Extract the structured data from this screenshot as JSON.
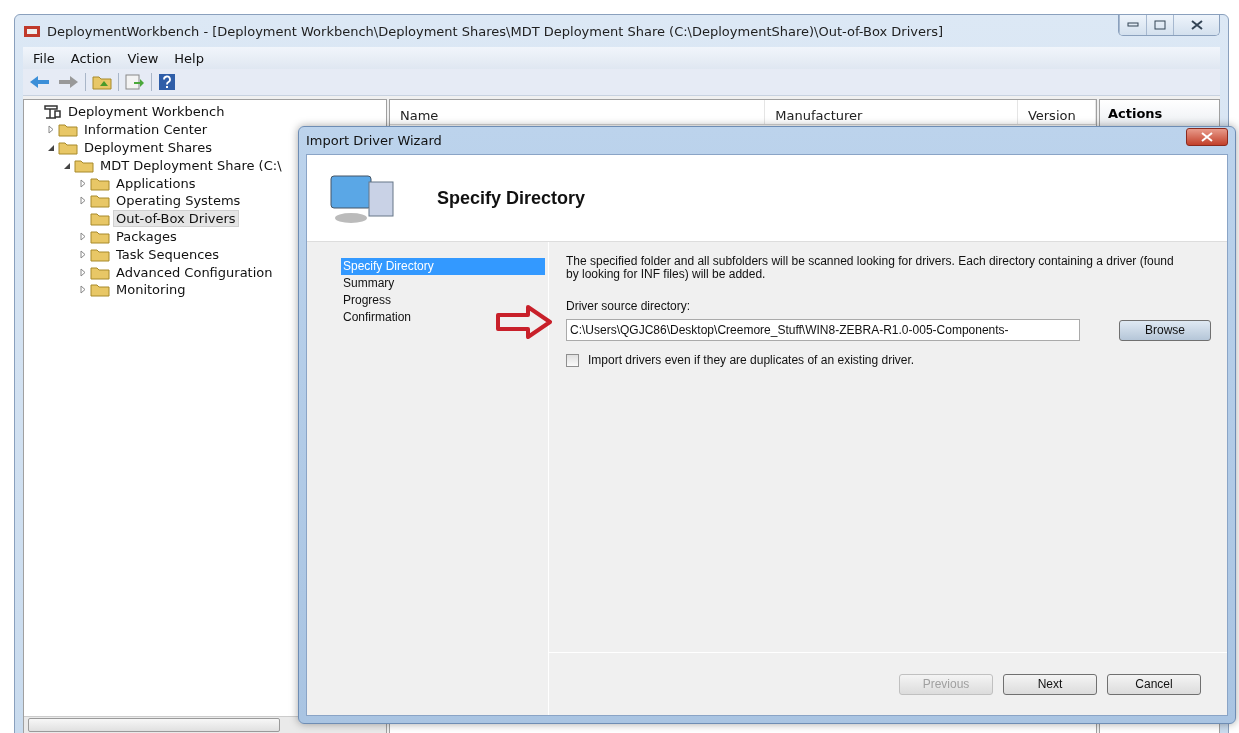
{
  "window": {
    "title": "DeploymentWorkbench - [Deployment Workbench\\Deployment Shares\\MDT Deployment Share (C:\\DeploymentShare)\\Out-of-Box Drivers]"
  },
  "menu": [
    "File",
    "Action",
    "View",
    "Help"
  ],
  "tree": [
    {
      "label": "Deployment Workbench",
      "selected": false,
      "children": [
        {
          "label": "Information Center",
          "selected": false,
          "expanded": false
        },
        {
          "label": "Deployment Shares",
          "selected": false,
          "expanded": true,
          "children": [
            {
              "label": "MDT Deployment Share (C:\\",
              "selected": false,
              "expanded": true,
              "children": [
                {
                  "label": "Applications",
                  "selected": false,
                  "expanded": false
                },
                {
                  "label": "Operating Systems",
                  "selected": false,
                  "expanded": false
                },
                {
                  "label": "Out-of-Box Drivers",
                  "selected": true
                },
                {
                  "label": "Packages",
                  "selected": false,
                  "expanded": false
                },
                {
                  "label": "Task Sequences",
                  "selected": false,
                  "expanded": false
                },
                {
                  "label": "Advanced Configuration",
                  "selected": false,
                  "expanded": false
                },
                {
                  "label": "Monitoring",
                  "selected": false,
                  "expanded": false
                }
              ]
            }
          ]
        }
      ]
    }
  ],
  "table": {
    "columns": [
      "Name",
      "Manufacturer",
      "Version"
    ]
  },
  "actions": {
    "title": "Actions"
  },
  "dialog": {
    "title": "Import Driver Wizard",
    "heading": "Specify Directory",
    "steps": [
      {
        "label": "Specify Directory",
        "selected": true
      },
      {
        "label": "Summary",
        "selected": false
      },
      {
        "label": "Progress",
        "selected": false
      },
      {
        "label": "Confirmation",
        "selected": false
      }
    ],
    "description": "The specified folder and all subfolders will be scanned looking for drivers.  Each directory containing a driver (found by looking for INF files) will be added.",
    "source_label": "Driver source directory:",
    "source_value": "C:\\Users\\QGJC86\\Desktop\\Creemore_Stuff\\WIN8-ZEBRA-R1.0-005-Components-",
    "browse": "Browse",
    "duplicates": {
      "label": "Import drivers even if they are duplicates of an existing driver.",
      "checked": false
    },
    "buttons": [
      {
        "label": "Previous",
        "disabled": true
      },
      {
        "label": "Next",
        "disabled": false
      },
      {
        "label": "Cancel",
        "disabled": false
      }
    ]
  }
}
